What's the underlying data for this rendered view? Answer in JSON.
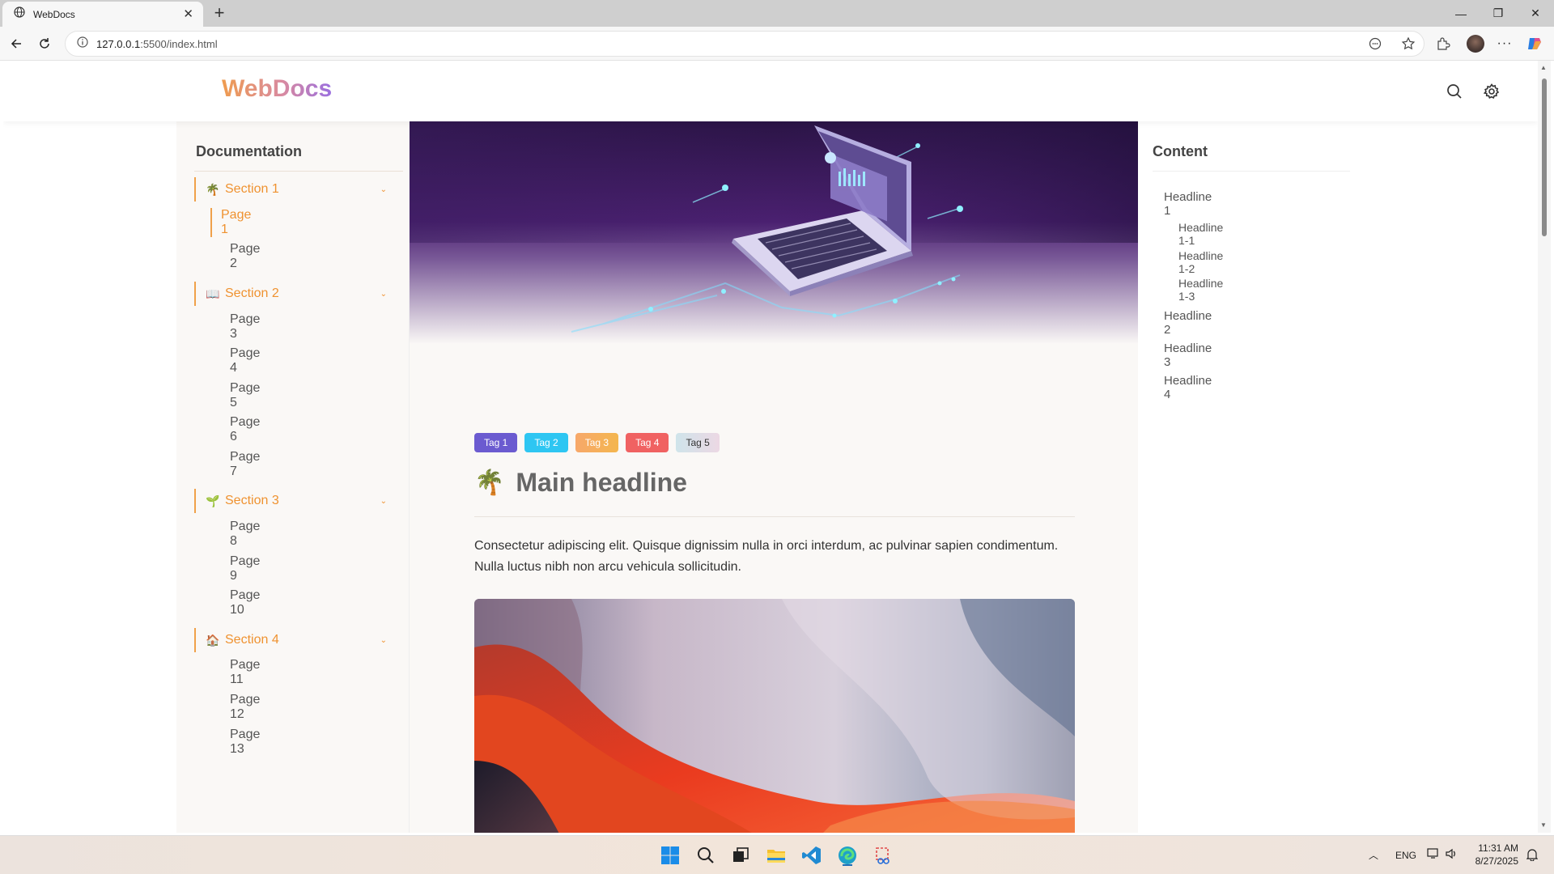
{
  "browser": {
    "tab_title": "WebDocs",
    "url_host": "127.0.0.1",
    "url_path": ":5500/index.html"
  },
  "site": {
    "logo": "WebDocs"
  },
  "sidebar": {
    "title": "Documentation",
    "sections": [
      {
        "emoji": "🌴",
        "label": "Section 1",
        "pages": [
          "Page 1",
          "Page 2"
        ]
      },
      {
        "emoji": "📖",
        "label": "Section 2",
        "pages": [
          "Page 3",
          "Page 4",
          "Page 5",
          "Page 6",
          "Page 7"
        ]
      },
      {
        "emoji": "🌱",
        "label": "Section 3",
        "pages": [
          "Page 8",
          "Page 9",
          "Page 10"
        ]
      },
      {
        "emoji": "🏠",
        "label": "Section 4",
        "pages": [
          "Page 11",
          "Page 12",
          "Page 13"
        ]
      }
    ]
  },
  "main": {
    "tags": [
      {
        "label": "Tag 1",
        "color": "#6b5bd0"
      },
      {
        "label": "Tag 2",
        "color": "#2ec6f2"
      },
      {
        "label": "Tag 3",
        "color": "#f7a86a"
      },
      {
        "label": "Tag 4",
        "color": "#f06262"
      },
      {
        "label": "Tag 5",
        "color": "#d8e3ea"
      }
    ],
    "headline_emoji": "🌴",
    "headline": "Main headline",
    "intro": "Consectetur adipiscing elit. Quisque dignissim nulla in orci interdum, ac pulvinar sapien condimentum. Nulla luctus nibh non arcu vehicula sollicitudin."
  },
  "toc": {
    "title": "Content",
    "items": [
      "Headline 1",
      "Headline 1-1",
      "Headline 1-2",
      "Headline 1-3",
      "Headline 2",
      "Headline 3",
      "Headline 4"
    ]
  },
  "taskbar": {
    "lang": "ENG",
    "time": "11:31 AM",
    "date": "8/27/2025"
  },
  "colors": {
    "accent": "#ef9230",
    "logo_gradient": [
      "#ef9c4f",
      "#9a6fe0"
    ]
  }
}
